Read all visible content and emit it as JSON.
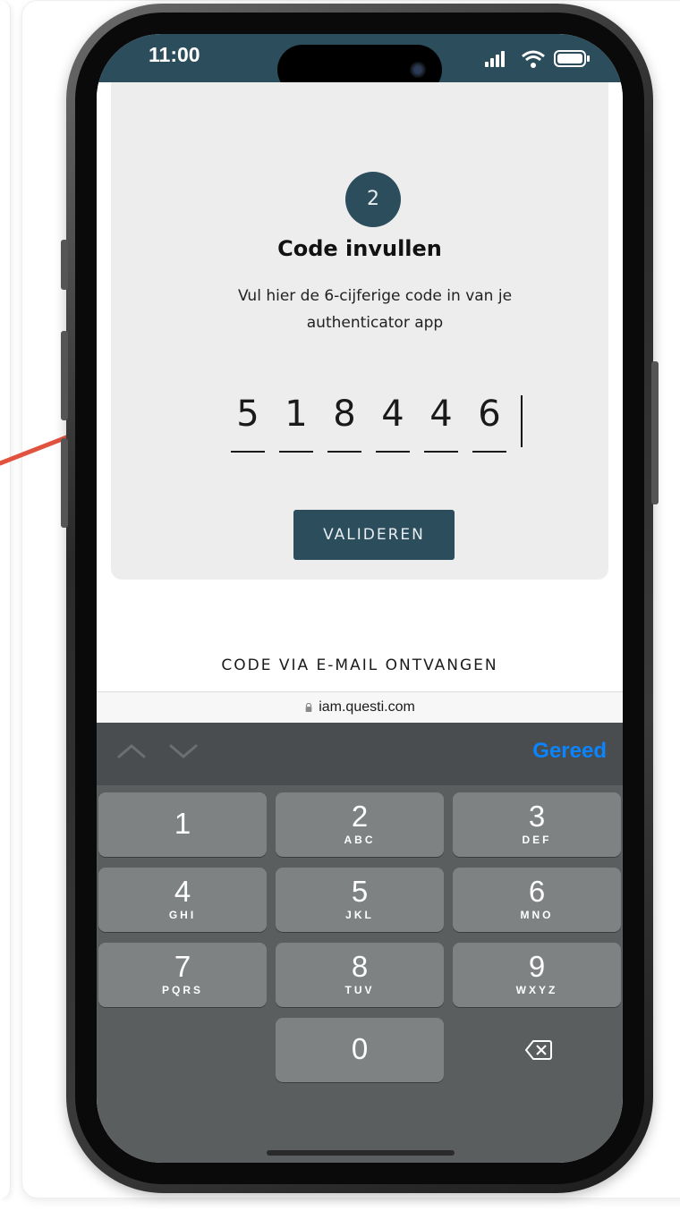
{
  "status_bar": {
    "time": "11:00",
    "background": "#2b4d5c"
  },
  "form": {
    "step_number": "2",
    "title": "Code invullen",
    "description": "Vul hier de 6-cijferige code in van je authenticator app",
    "code_digits": [
      "5",
      "1",
      "8",
      "4",
      "4",
      "6"
    ],
    "validate_label": "VALIDEREN",
    "accent_color": "#2b4d5c"
  },
  "email_link": "CODE VIA E-MAIL ONTVANGEN",
  "browser": {
    "url": "iam.questi.com"
  },
  "keyboard": {
    "done_label": "Gereed",
    "done_color": "#0a84ff",
    "keys": [
      {
        "num": "1",
        "letters": ""
      },
      {
        "num": "2",
        "letters": "ABC"
      },
      {
        "num": "3",
        "letters": "DEF"
      },
      {
        "num": "4",
        "letters": "GHI"
      },
      {
        "num": "5",
        "letters": "JKL"
      },
      {
        "num": "6",
        "letters": "MNO"
      },
      {
        "num": "7",
        "letters": "PQRS"
      },
      {
        "num": "8",
        "letters": "TUV"
      },
      {
        "num": "9",
        "letters": "WXYZ"
      },
      {
        "num": "0",
        "letters": ""
      }
    ]
  },
  "icons": [
    "arrow-annotation-icon",
    "signal-icon",
    "wifi-icon",
    "battery-icon",
    "lock-icon",
    "chevron-up-icon",
    "chevron-down-icon",
    "delete-icon"
  ]
}
